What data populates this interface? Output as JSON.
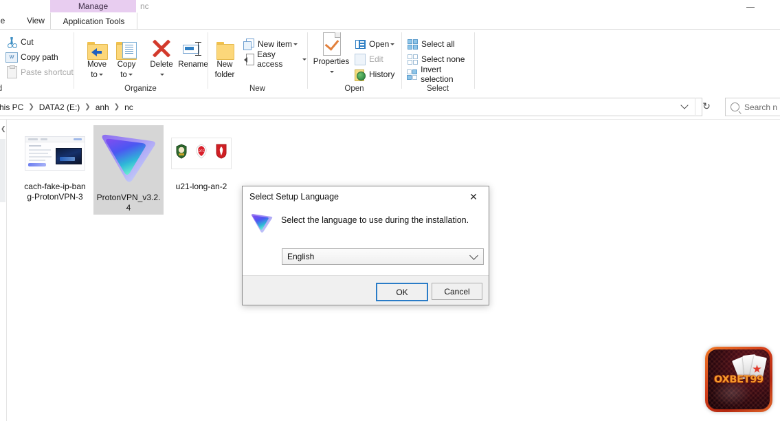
{
  "window": {
    "contextual_tab_group": "Manage",
    "path_caption": "nc",
    "minimize_label": "Minimize"
  },
  "tabs": [
    {
      "id": "file",
      "label": "e"
    },
    {
      "id": "view",
      "label": "View"
    },
    {
      "id": "apptools",
      "label": "Application Tools"
    }
  ],
  "ribbon": {
    "groups": [
      {
        "id": "clipboard",
        "label": "d"
      },
      {
        "id": "organize",
        "label": "Organize"
      },
      {
        "id": "new",
        "label": "New"
      },
      {
        "id": "open",
        "label": "Open"
      },
      {
        "id": "select",
        "label": "Select"
      }
    ],
    "clipboard": {
      "cut": "Cut",
      "copy_path": "Copy path",
      "paste_shortcut": "Paste shortcut"
    },
    "organize": {
      "move_to": "Move",
      "move_to_2": "to",
      "copy_to": "Copy",
      "copy_to_2": "to",
      "delete": "Delete",
      "rename": "Rename"
    },
    "new": {
      "new_folder": "New",
      "new_folder_2": "folder",
      "new_item": "New item",
      "easy_access": "Easy access"
    },
    "open_group": {
      "properties": "Properties",
      "open": "Open",
      "edit": "Edit",
      "history": "History"
    },
    "select_group": {
      "select_all": "Select all",
      "select_none": "Select none",
      "invert_selection": "Invert selection"
    }
  },
  "address_bar": {
    "crumbs": [
      "his PC",
      "DATA2 (E:)",
      "anh",
      "nc"
    ],
    "refresh_glyph": "↻",
    "search_text": "Search n"
  },
  "files": [
    {
      "name_line1": "cach-fake-ip-ban",
      "name_line2": "g-ProtonVPN-3",
      "thumb": "webpage-screenshot",
      "selected": false
    },
    {
      "name_line1": "ProtonVPN_v3.2.",
      "name_line2": "4",
      "thumb": "protonvpn-logo",
      "selected": true
    },
    {
      "name_line1": "u21-long-an-2",
      "name_line2": "",
      "thumb": "three-club-crests",
      "selected": false
    }
  ],
  "dialog": {
    "title": "Select Setup Language",
    "close_glyph": "✕",
    "message": "Select the language to use during the installation.",
    "language_value": "English",
    "ok_label": "OK",
    "cancel_label": "Cancel"
  },
  "watermark": {
    "brand": "OXBET99"
  },
  "colors": {
    "contextual_tab": "#e8cdf0",
    "selection": "#d6d6d6",
    "default_button_border": "#2a7cc7",
    "delete_red": "#d33a2c",
    "folder_yellow": "#fcd77a",
    "brand_orange": "#f79b2c"
  }
}
